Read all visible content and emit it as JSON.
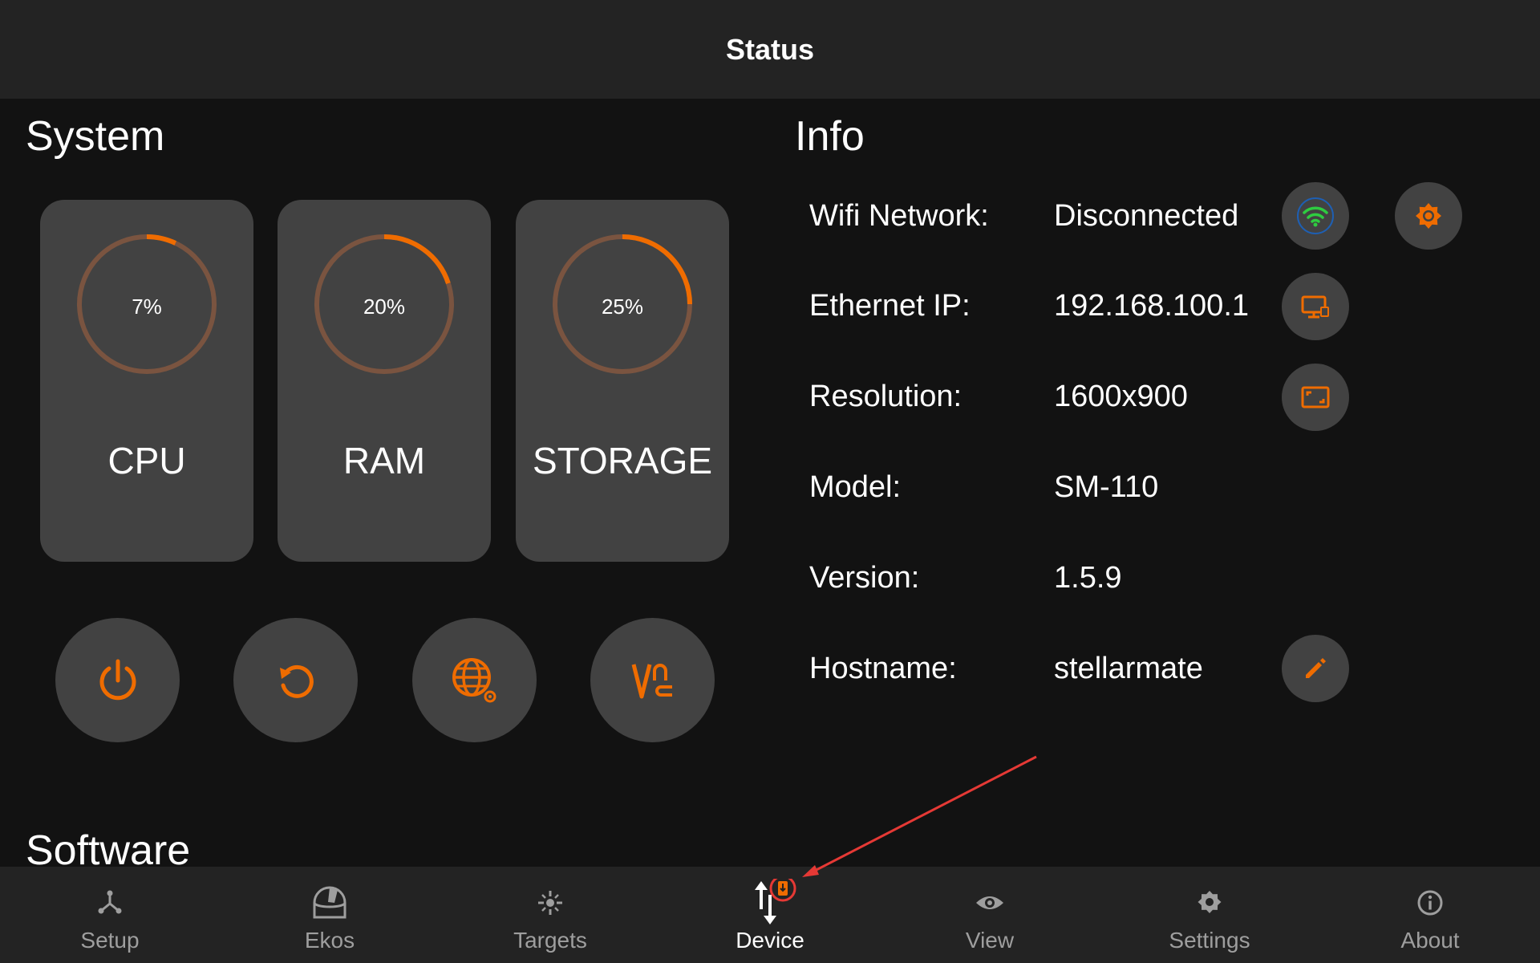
{
  "header": {
    "title": "Status"
  },
  "system": {
    "title": "System",
    "cards": [
      {
        "label": "CPU",
        "percent_text": "7%",
        "value": 7
      },
      {
        "label": "RAM",
        "percent_text": "20%",
        "value": 20
      },
      {
        "label": "STORAGE",
        "percent_text": "25%",
        "value": 25
      }
    ],
    "actions": [
      {
        "icon": "power-icon"
      },
      {
        "icon": "restart-icon"
      },
      {
        "icon": "globe-settings-icon"
      },
      {
        "icon": "vnc-icon"
      }
    ]
  },
  "info": {
    "title": "Info",
    "rows": [
      {
        "label": "Wifi Network:",
        "value": "Disconnected"
      },
      {
        "label": "Ethernet IP:",
        "value": "192.168.100.1"
      },
      {
        "label": "Resolution:",
        "value": "1600x900"
      },
      {
        "label": "Model:",
        "value": "SM-110"
      },
      {
        "label": "Version:",
        "value": "1.5.9"
      },
      {
        "label": "Hostname:",
        "value": "stellarmate"
      }
    ]
  },
  "software": {
    "title": "Software"
  },
  "nav": {
    "items": [
      {
        "label": "Setup",
        "icon": "setup-icon"
      },
      {
        "label": "Ekos",
        "icon": "ekos-icon"
      },
      {
        "label": "Targets",
        "icon": "targets-icon"
      },
      {
        "label": "Device",
        "icon": "device-icon",
        "active": true
      },
      {
        "label": "View",
        "icon": "eye-icon"
      },
      {
        "label": "Settings",
        "icon": "settings-gear-icon"
      },
      {
        "label": "About",
        "icon": "info-icon"
      }
    ]
  },
  "colors": {
    "accent": "#ef6c00",
    "ring_track": "#7a5440",
    "card": "#424242",
    "background": "#121212",
    "bar": "#232323",
    "wifi_green": "#2ecc40",
    "annotation_red": "#e53935"
  }
}
